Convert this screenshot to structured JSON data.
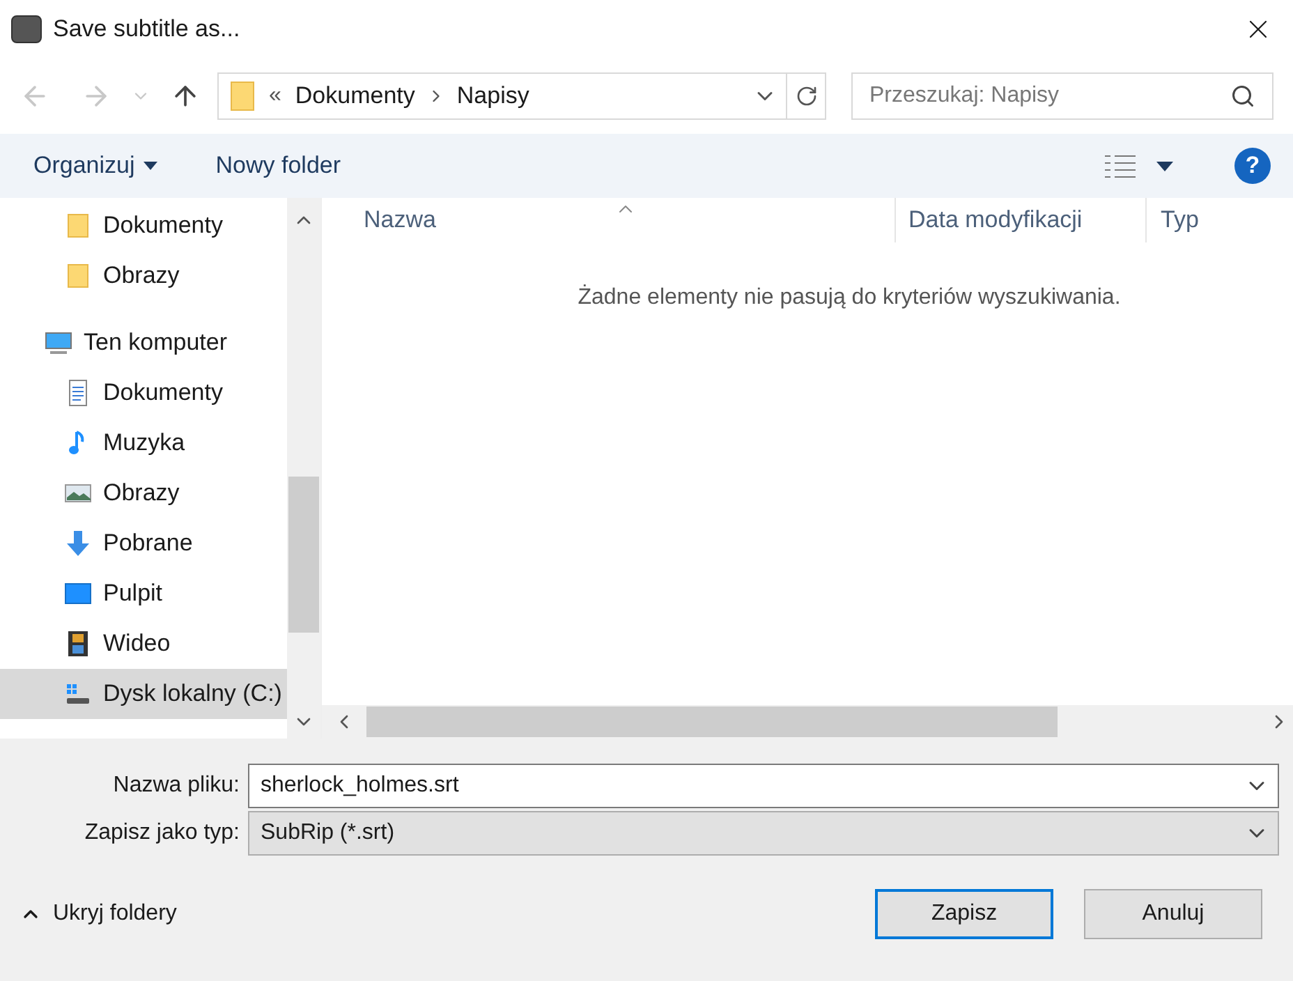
{
  "window": {
    "title": "Save subtitle as..."
  },
  "address": {
    "prefix": "«",
    "crumbs": [
      "Dokumenty",
      "Napisy"
    ]
  },
  "search": {
    "placeholder": "Przeszukaj: Napisy"
  },
  "toolbar": {
    "organize": "Organizuj",
    "new_folder": "Nowy folder"
  },
  "sidebar": {
    "items": [
      {
        "label": "Dokumenty",
        "kind": "folder",
        "selected": false
      },
      {
        "label": "Obrazy",
        "kind": "folder",
        "selected": false
      },
      {
        "label": "Ten komputer",
        "kind": "computer",
        "selected": false,
        "children": [
          {
            "label": "Dokumenty",
            "kind": "document",
            "selected": false
          },
          {
            "label": "Muzyka",
            "kind": "music",
            "selected": false
          },
          {
            "label": "Obrazy",
            "kind": "picture",
            "selected": false
          },
          {
            "label": "Pobrane",
            "kind": "download",
            "selected": false
          },
          {
            "label": "Pulpit",
            "kind": "desktop",
            "selected": false
          },
          {
            "label": "Wideo",
            "kind": "video",
            "selected": false
          },
          {
            "label": "Dysk lokalny (C:)",
            "kind": "drive",
            "selected": true
          }
        ]
      }
    ]
  },
  "table": {
    "columns": [
      "Nazwa",
      "Data modyfikacji",
      "Typ"
    ],
    "empty_message": "Żadne elementy nie pasują do kryteriów wyszukiwania."
  },
  "form": {
    "filename_label": "Nazwa pliku:",
    "filename": "sherlock_holmes.srt",
    "type_label": "Zapisz jako typ:",
    "type": "SubRip (*.srt)"
  },
  "help": "?",
  "hide_folders": "Ukryj foldery",
  "buttons": [
    "Zapisz",
    "Anuluj"
  ]
}
